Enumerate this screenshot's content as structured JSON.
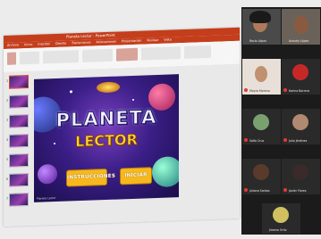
{
  "powerpoint": {
    "title": "Planeta Lector - PowerPoint",
    "ribbon_tabs": [
      "Archivo",
      "Inicio",
      "Insertar",
      "Diseño",
      "Transiciones",
      "Animaciones",
      "Presentación",
      "Revisar",
      "Vista"
    ],
    "thumbnails": [
      "1",
      "2",
      "3",
      "4",
      "5",
      "6",
      "7"
    ],
    "selected_thumbnail": 0
  },
  "slide": {
    "title_line1": "PLANETA",
    "title_line2": "LECTOR",
    "button_left": "INSTRUCCIONES",
    "button_right": "INICIAR",
    "caption": "Planeta Lector"
  },
  "participants": [
    {
      "name": "Rocío López",
      "type": "video"
    },
    {
      "name": "Aracely López",
      "type": "video"
    },
    {
      "name": "Mayra Moreno",
      "type": "video"
    },
    {
      "name": "Karina Barrera",
      "type": "avatar"
    },
    {
      "name": "Sofía Cruz",
      "type": "avatar"
    },
    {
      "name": "Julio Jiménez",
      "type": "avatar"
    },
    {
      "name": "Juliana Santos",
      "type": "avatar"
    },
    {
      "name": "Javier Flores",
      "type": "avatar"
    },
    {
      "name": "Jimena Ortiz",
      "type": "avatar"
    }
  ],
  "colors": {
    "ppt_accent": "#c43e1c",
    "slide_button": "#f6b81c",
    "mic_muted": "#e53935"
  }
}
